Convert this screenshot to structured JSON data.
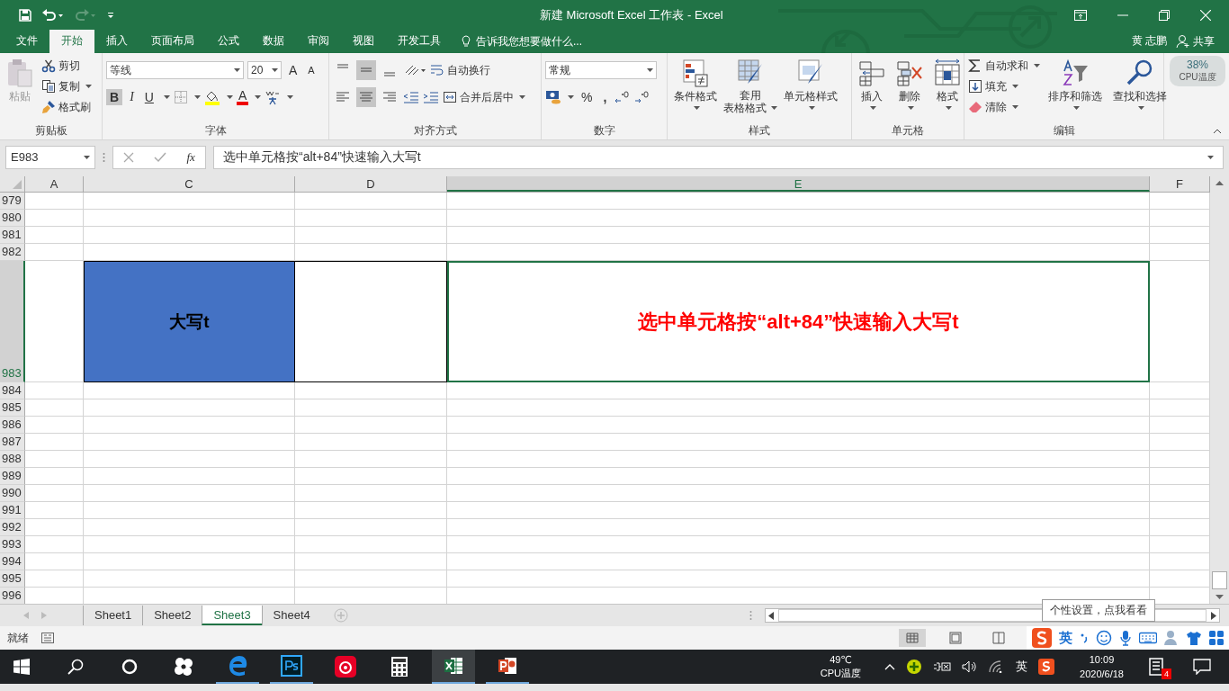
{
  "title_bar": {
    "title": "新建 Microsoft Excel 工作表 - Excel"
  },
  "ribbon_tabs": [
    {
      "label": "文件",
      "selected": false
    },
    {
      "label": "开始",
      "selected": true
    },
    {
      "label": "插入",
      "selected": false
    },
    {
      "label": "页面布局",
      "selected": false
    },
    {
      "label": "公式",
      "selected": false
    },
    {
      "label": "数据",
      "selected": false
    },
    {
      "label": "审阅",
      "selected": false
    },
    {
      "label": "视图",
      "selected": false
    },
    {
      "label": "开发工具",
      "selected": false
    }
  ],
  "tell_me": {
    "placeholder": "告诉我您想要做什么..."
  },
  "user": {
    "name": "黄 志鹏",
    "share": "共享"
  },
  "cpu_widget": {
    "percent": "38%",
    "label": "CPU温度"
  },
  "ribbon": {
    "clipboard": {
      "label": "剪贴板",
      "paste": "粘贴",
      "cut": "剪切",
      "copy": "复制",
      "format_painter": "格式刷"
    },
    "font": {
      "label": "字体",
      "font_name": "等线",
      "font_size": "20",
      "grow": "A",
      "shrink": "A",
      "bold": "B",
      "italic": "I",
      "underline": "U",
      "font_color": "A",
      "bold_on": true
    },
    "alignment": {
      "label": "对齐方式",
      "wrap": "自动换行",
      "merge": "合并后居中",
      "vertical_buttons": [
        {
          "selected": false
        },
        {
          "selected": true
        },
        {
          "selected": false
        }
      ],
      "horizontal_buttons": [
        {
          "selected": false
        },
        {
          "selected": true
        },
        {
          "selected": false
        }
      ]
    },
    "number": {
      "label": "数字",
      "format": "常规",
      "percent": "%",
      "comma": ","
    },
    "styles": {
      "label": "样式",
      "conditional": "条件格式",
      "table_format": [
        "套用",
        "表格格式"
      ],
      "cell_styles": "单元格样式"
    },
    "cells": {
      "label": "单元格",
      "insert": "插入",
      "delete": "删除",
      "format": "格式"
    },
    "editing": {
      "label": "编辑",
      "autosum": "自动求和",
      "fill": "填充",
      "clear": "清除",
      "sort": "排序和筛选",
      "find": "查找和选择"
    }
  },
  "formula_bar": {
    "name_box": "E983",
    "fx": "fx",
    "formula": "选中单元格按“alt+84”快速输入大写t"
  },
  "columns": [
    {
      "label": "A",
      "selected": false
    },
    {
      "label": "C",
      "selected": false
    },
    {
      "label": "D",
      "selected": false
    },
    {
      "label": "E",
      "selected": true
    },
    {
      "label": "F",
      "selected": false
    }
  ],
  "rows": [
    {
      "number": "979",
      "selected": false
    },
    {
      "number": "980",
      "selected": false
    },
    {
      "number": "981",
      "selected": false
    },
    {
      "number": "982",
      "selected": false
    },
    {
      "number": "983",
      "selected": true,
      "c": "大写t",
      "e": "选中单元格按“alt+84”快速输入大写t"
    },
    {
      "number": "984",
      "selected": false
    },
    {
      "number": "985",
      "selected": false
    },
    {
      "number": "986",
      "selected": false
    },
    {
      "number": "987",
      "selected": false
    },
    {
      "number": "988",
      "selected": false
    },
    {
      "number": "989",
      "selected": false
    },
    {
      "number": "990",
      "selected": false
    },
    {
      "number": "991",
      "selected": false
    },
    {
      "number": "992",
      "selected": false
    },
    {
      "number": "993",
      "selected": false
    },
    {
      "number": "994",
      "selected": false
    },
    {
      "number": "995",
      "selected": false
    },
    {
      "number": "996",
      "selected": false
    }
  ],
  "sheet_tabs": [
    {
      "label": "Sheet1",
      "selected": false
    },
    {
      "label": "Sheet2",
      "selected": false
    },
    {
      "label": "Sheet3",
      "selected": true
    },
    {
      "label": "Sheet4",
      "selected": false
    }
  ],
  "ime_tooltip": "个性设置，点我看看",
  "status_bar": {
    "status": "就绪",
    "ime_mode": "英"
  },
  "taskbar": {
    "temperature": "49℃",
    "temperature_label": "CPU温度",
    "ime": "英",
    "time": "10:09",
    "date": "2020/6/18",
    "notifications": "4"
  }
}
